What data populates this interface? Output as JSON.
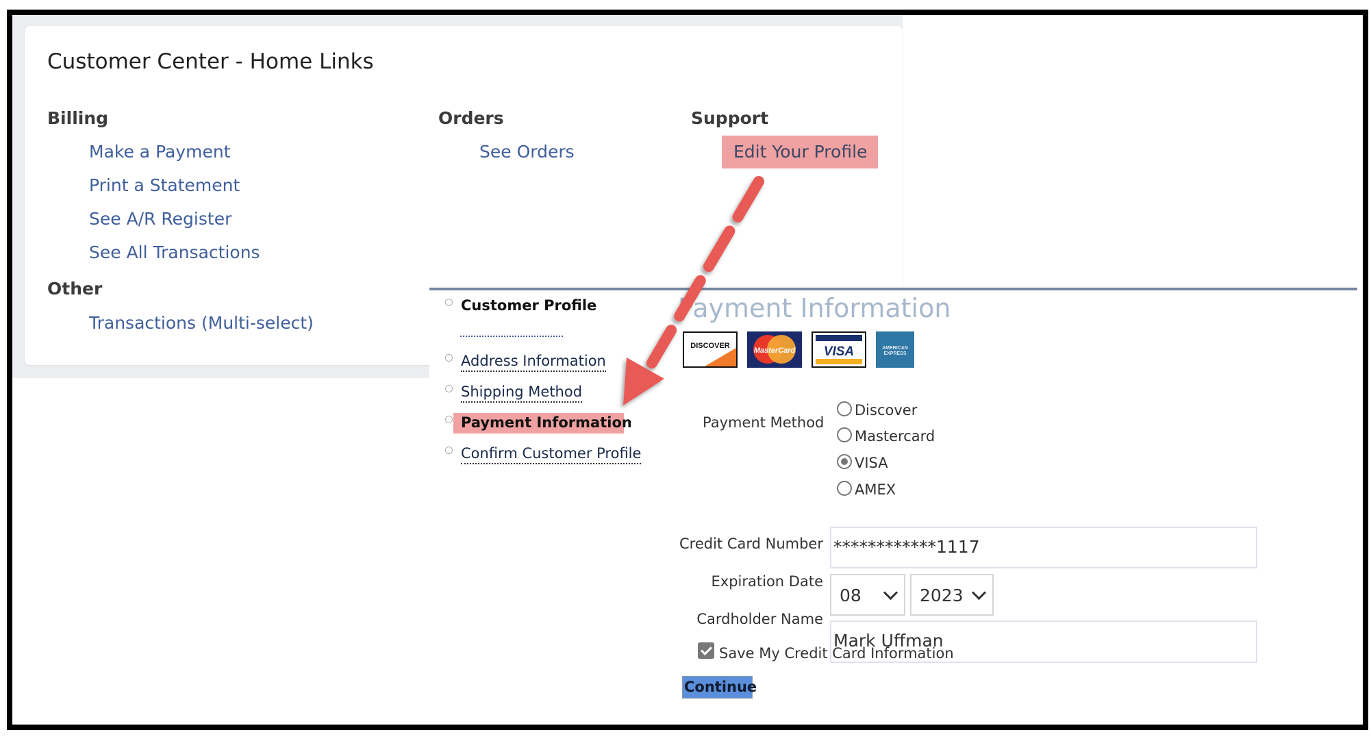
{
  "home_links": {
    "title": "Customer Center - Home Links",
    "billing": {
      "heading": "Billing",
      "links": [
        "Make a Payment",
        "Print a Statement",
        "See A/R Register",
        "See All Transactions"
      ]
    },
    "other": {
      "heading": "Other",
      "links": [
        "Transactions (Multi-select)"
      ]
    },
    "orders": {
      "heading": "Orders",
      "links": [
        "See Orders"
      ]
    },
    "support": {
      "heading": "Support",
      "links": [
        "Edit Your Profile"
      ]
    }
  },
  "profile_nav": {
    "items": [
      {
        "label": "Customer Profile",
        "state": "header"
      },
      {
        "label": "Address Information",
        "state": "link"
      },
      {
        "label": "Shipping Method",
        "state": "link"
      },
      {
        "label": "Payment Information",
        "state": "current"
      },
      {
        "label": "Confirm Customer Profile",
        "state": "link"
      }
    ]
  },
  "payment": {
    "title": "Payment Information",
    "card_logos": [
      "DISCOVER",
      "MasterCard",
      "VISA",
      "AMERICAN EXPRESS"
    ],
    "method_label": "Payment Method",
    "methods": [
      "Discover",
      "Mastercard",
      "VISA",
      "AMEX"
    ],
    "selected_method": "VISA",
    "card_number_label": "Credit Card Number",
    "card_number_value": "************1117",
    "expiration_label": "Expiration Date",
    "exp_month": "08",
    "exp_year": "2023",
    "cardholder_label": "Cardholder Name",
    "cardholder_value": "Mark Uffman",
    "save_card_label": "Save My Credit Card Information",
    "save_card_checked": true,
    "continue_label": "Continue"
  },
  "annotation": {
    "highlight_color": "#f0a1a1",
    "arrow_color": "#e85a56"
  }
}
